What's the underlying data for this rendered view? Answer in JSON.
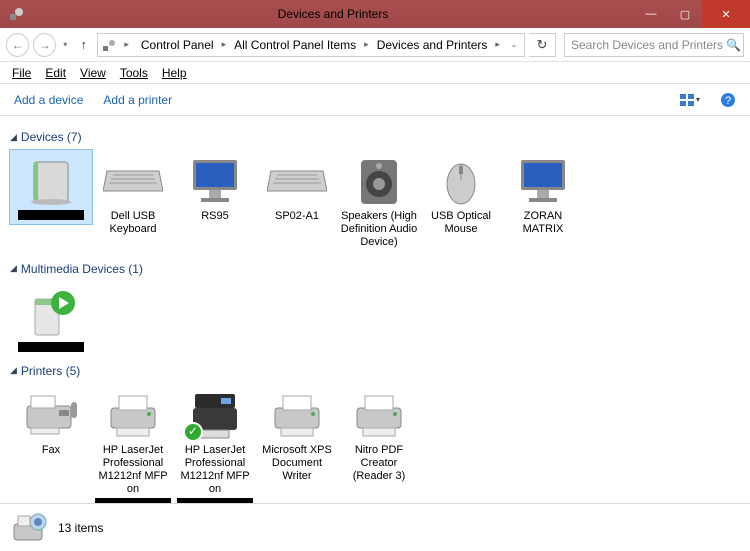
{
  "window": {
    "title": "Devices and Printers"
  },
  "breadcrumbs": [
    "Control Panel",
    "All Control Panel Items",
    "Devices and Printers"
  ],
  "search": {
    "placeholder": "Search Devices and Printers"
  },
  "menu": [
    "File",
    "Edit",
    "View",
    "Tools",
    "Help"
  ],
  "commands": {
    "add_device": "Add a device",
    "add_printer": "Add a printer"
  },
  "groups": [
    {
      "title": "Devices (7)",
      "items": [
        {
          "label": "",
          "icon": "drive",
          "redacted": true,
          "selected": true
        },
        {
          "label": "Dell USB Keyboard",
          "icon": "keyboard"
        },
        {
          "label": "RS95",
          "icon": "monitor"
        },
        {
          "label": "SP02-A1",
          "icon": "keyboard"
        },
        {
          "label": "Speakers (High Definition Audio Device)",
          "icon": "speaker"
        },
        {
          "label": "USB Optical Mouse",
          "icon": "mouse"
        },
        {
          "label": "ZORAN MATRIX",
          "icon": "monitor"
        }
      ]
    },
    {
      "title": "Multimedia Devices (1)",
      "items": [
        {
          "label": "",
          "icon": "mediaserver",
          "redacted": true
        }
      ]
    },
    {
      "title": "Printers (5)",
      "items": [
        {
          "label": "Fax",
          "icon": "fax"
        },
        {
          "label": "HP LaserJet Professional M1212nf MFP on",
          "icon": "printer",
          "redacted_below": true
        },
        {
          "label": "HP LaserJet Professional M1212nf MFP on",
          "icon": "mfp",
          "default": true,
          "redacted_below": true
        },
        {
          "label": "Microsoft XPS Document Writer",
          "icon": "printer"
        },
        {
          "label": "Nitro PDF Creator (Reader 3)",
          "icon": "printer"
        }
      ]
    }
  ],
  "statusbar": {
    "count": "13 items"
  }
}
